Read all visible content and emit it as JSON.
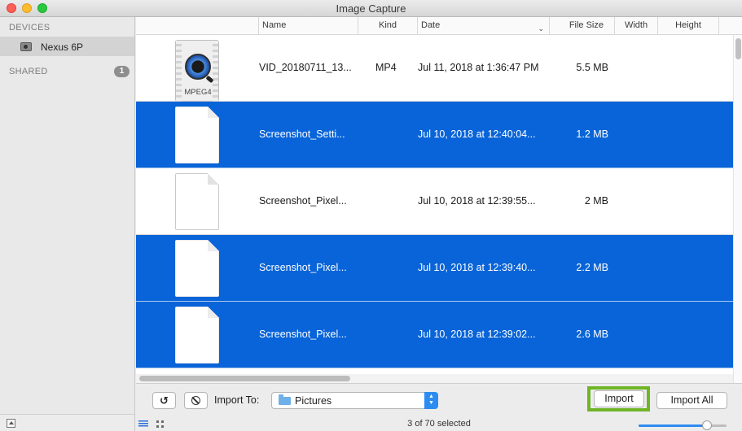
{
  "window": {
    "title": "Image Capture"
  },
  "sidebar": {
    "devices_heading": "DEVICES",
    "device_name": "Nexus 6P",
    "shared_heading": "SHARED",
    "shared_count": "1"
  },
  "columns": {
    "name": "Name",
    "kind": "Kind",
    "date": "Date",
    "size": "File Size",
    "width": "Width",
    "height": "Height"
  },
  "rows": [
    {
      "name": "VID_20180711_13...",
      "kind": "MP4",
      "date": "Jul 11, 2018 at 1:36:47 PM",
      "size": "5.5 MB",
      "selected": false,
      "thumb": "mpeg4",
      "thumb_label": "MPEG4"
    },
    {
      "name": "Screenshot_Setti...",
      "kind": "",
      "date": "Jul 10, 2018 at 12:40:04...",
      "size": "1.2 MB",
      "selected": true,
      "thumb": "document"
    },
    {
      "name": "Screenshot_Pixel...",
      "kind": "",
      "date": "Jul 10, 2018 at 12:39:55...",
      "size": "2 MB",
      "selected": false,
      "thumb": "document"
    },
    {
      "name": "Screenshot_Pixel...",
      "kind": "",
      "date": "Jul 10, 2018 at 12:39:40...",
      "size": "2.2 MB",
      "selected": true,
      "thumb": "document"
    },
    {
      "name": "Screenshot_Pixel...",
      "kind": "",
      "date": "Jul 10, 2018 at 12:39:02...",
      "size": "2.6 MB",
      "selected": true,
      "thumb": "document"
    }
  ],
  "toolbar": {
    "rotate_label": "↺",
    "import_to_label": "Import To:",
    "destination": "Pictures",
    "import_label": "Import",
    "import_all_label": "Import All",
    "status": "3 of 70 selected",
    "thumbnail_size_fraction": 0.78
  },
  "colors": {
    "selection": "#0864d8",
    "import_highlight": "#6fb526",
    "accent": "#2d8cf0"
  }
}
